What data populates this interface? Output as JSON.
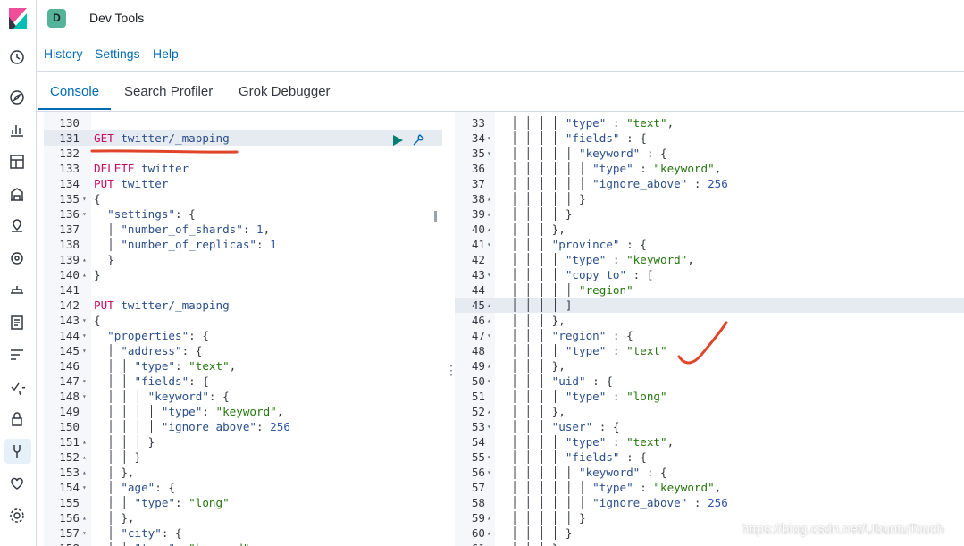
{
  "header": {
    "space_initial": "D",
    "app_title": "Dev Tools"
  },
  "menu": {
    "items": [
      "History",
      "Settings",
      "Help"
    ]
  },
  "tabs": [
    {
      "label": "Console",
      "active": true
    },
    {
      "label": "Search Profiler",
      "active": false
    },
    {
      "label": "Grok Debugger",
      "active": false
    }
  ],
  "rail_icons": [
    "clock-icon",
    "compass-icon",
    "visualize-icon",
    "dashboard-icon",
    "canvas-icon",
    "maps-icon",
    "ml-icon",
    "infrastructure-icon",
    "logs-icon",
    "apm-icon",
    "uptime-icon",
    "siem-icon",
    "dev-tools-icon",
    "monitoring-icon",
    "management-icon"
  ],
  "request_editor": {
    "lines": [
      {
        "n": "130",
        "fold": "",
        "t": []
      },
      {
        "n": "131",
        "fold": "",
        "hl": true,
        "t": [
          [
            "kw",
            "GET "
          ],
          [
            "url",
            "twitter/_mapping"
          ]
        ]
      },
      {
        "n": "132",
        "fold": "",
        "t": []
      },
      {
        "n": "133",
        "fold": "",
        "t": [
          [
            "kw",
            "DELETE "
          ],
          [
            "url",
            "twitter"
          ]
        ]
      },
      {
        "n": "134",
        "fold": "",
        "t": [
          [
            "kw",
            "PUT "
          ],
          [
            "url",
            "twitter"
          ]
        ]
      },
      {
        "n": "135",
        "fold": "▾",
        "t": [
          [
            "pun",
            "{"
          ]
        ]
      },
      {
        "n": "136",
        "fold": "▾",
        "t": [
          [
            "pun",
            "  "
          ],
          [
            "key",
            "\"settings\""
          ],
          [
            "pun",
            ": {"
          ]
        ]
      },
      {
        "n": "137",
        "fold": "",
        "t": [
          [
            "pun",
            "  │ "
          ],
          [
            "key",
            "\"number_of_shards\""
          ],
          [
            "pun",
            ": "
          ],
          [
            "num",
            "1"
          ],
          [
            "pun",
            ","
          ]
        ]
      },
      {
        "n": "138",
        "fold": "",
        "t": [
          [
            "pun",
            "  │ "
          ],
          [
            "key",
            "\"number_of_replicas\""
          ],
          [
            "pun",
            ": "
          ],
          [
            "num",
            "1"
          ]
        ]
      },
      {
        "n": "139",
        "fold": "▴",
        "t": [
          [
            "pun",
            "  }"
          ]
        ]
      },
      {
        "n": "140",
        "fold": "▴",
        "t": [
          [
            "pun",
            "}"
          ]
        ]
      },
      {
        "n": "141",
        "fold": "",
        "t": []
      },
      {
        "n": "142",
        "fold": "",
        "t": [
          [
            "kw",
            "PUT "
          ],
          [
            "url",
            "twitter/_mapping"
          ]
        ]
      },
      {
        "n": "143",
        "fold": "▾",
        "t": [
          [
            "pun",
            "{"
          ]
        ]
      },
      {
        "n": "144",
        "fold": "▾",
        "t": [
          [
            "pun",
            "  "
          ],
          [
            "key",
            "\"properties\""
          ],
          [
            "pun",
            ": {"
          ]
        ]
      },
      {
        "n": "145",
        "fold": "▾",
        "t": [
          [
            "pun",
            "  │ "
          ],
          [
            "key",
            "\"address\""
          ],
          [
            "pun",
            ": {"
          ]
        ]
      },
      {
        "n": "146",
        "fold": "",
        "t": [
          [
            "pun",
            "  │ │ "
          ],
          [
            "key",
            "\"type\""
          ],
          [
            "pun",
            ": "
          ],
          [
            "str",
            "\"text\""
          ],
          [
            "pun",
            ","
          ]
        ]
      },
      {
        "n": "147",
        "fold": "▾",
        "t": [
          [
            "pun",
            "  │ │ "
          ],
          [
            "key",
            "\"fields\""
          ],
          [
            "pun",
            ": {"
          ]
        ]
      },
      {
        "n": "148",
        "fold": "▾",
        "t": [
          [
            "pun",
            "  │ │ │ "
          ],
          [
            "key",
            "\"keyword\""
          ],
          [
            "pun",
            ": {"
          ]
        ]
      },
      {
        "n": "149",
        "fold": "",
        "t": [
          [
            "pun",
            "  │ │ │ │ "
          ],
          [
            "key",
            "\"type\""
          ],
          [
            "pun",
            ": "
          ],
          [
            "str",
            "\"keyword\""
          ],
          [
            "pun",
            ","
          ]
        ]
      },
      {
        "n": "150",
        "fold": "",
        "t": [
          [
            "pun",
            "  │ │ │ │ "
          ],
          [
            "key",
            "\"ignore_above\""
          ],
          [
            "pun",
            ": "
          ],
          [
            "num",
            "256"
          ]
        ]
      },
      {
        "n": "151",
        "fold": "▴",
        "t": [
          [
            "pun",
            "  │ │ │ }"
          ]
        ]
      },
      {
        "n": "152",
        "fold": "▴",
        "t": [
          [
            "pun",
            "  │ │ }"
          ]
        ]
      },
      {
        "n": "153",
        "fold": "▴",
        "t": [
          [
            "pun",
            "  │ },"
          ]
        ]
      },
      {
        "n": "154",
        "fold": "▾",
        "t": [
          [
            "pun",
            "  │ "
          ],
          [
            "key",
            "\"age\""
          ],
          [
            "pun",
            ": {"
          ]
        ]
      },
      {
        "n": "155",
        "fold": "",
        "t": [
          [
            "pun",
            "  │ │ "
          ],
          [
            "key",
            "\"type\""
          ],
          [
            "pun",
            ": "
          ],
          [
            "str",
            "\"long\""
          ]
        ]
      },
      {
        "n": "156",
        "fold": "▴",
        "t": [
          [
            "pun",
            "  │ },"
          ]
        ]
      },
      {
        "n": "157",
        "fold": "▾",
        "t": [
          [
            "pun",
            "  │ "
          ],
          [
            "key",
            "\"city\""
          ],
          [
            "pun",
            ": {"
          ]
        ]
      },
      {
        "n": "158",
        "fold": "",
        "t": [
          [
            "pun",
            "  │ │ "
          ],
          [
            "key",
            "\"type\""
          ],
          [
            "pun",
            ": "
          ],
          [
            "str",
            "\"keyword\""
          ]
        ]
      }
    ]
  },
  "response_editor": {
    "lines": [
      {
        "n": "33",
        "fold": "",
        "t": [
          [
            "pun",
            "  │ │ │ │ "
          ],
          [
            "key",
            "\"type\""
          ],
          [
            "pun",
            " : "
          ],
          [
            "str",
            "\"text\""
          ],
          [
            "pun",
            ","
          ]
        ]
      },
      {
        "n": "34",
        "fold": "▾",
        "t": [
          [
            "pun",
            "  │ │ │ │ "
          ],
          [
            "key",
            "\"fields\""
          ],
          [
            "pun",
            " : {"
          ]
        ]
      },
      {
        "n": "35",
        "fold": "▾",
        "t": [
          [
            "pun",
            "  │ │ │ │ │ "
          ],
          [
            "key",
            "\"keyword\""
          ],
          [
            "pun",
            " : {"
          ]
        ]
      },
      {
        "n": "36",
        "fold": "",
        "t": [
          [
            "pun",
            "  │ │ │ │ │ │ "
          ],
          [
            "key",
            "\"type\""
          ],
          [
            "pun",
            " : "
          ],
          [
            "str",
            "\"keyword\""
          ],
          [
            "pun",
            ","
          ]
        ]
      },
      {
        "n": "37",
        "fold": "",
        "t": [
          [
            "pun",
            "  │ │ │ │ │ │ "
          ],
          [
            "key",
            "\"ignore_above\""
          ],
          [
            "pun",
            " : "
          ],
          [
            "num",
            "256"
          ]
        ]
      },
      {
        "n": "38",
        "fold": "▴",
        "t": [
          [
            "pun",
            "  │ │ │ │ │ }"
          ]
        ]
      },
      {
        "n": "39",
        "fold": "▴",
        "t": [
          [
            "pun",
            "  │ │ │ │ }"
          ]
        ]
      },
      {
        "n": "40",
        "fold": "▴",
        "t": [
          [
            "pun",
            "  │ │ │ },"
          ]
        ]
      },
      {
        "n": "41",
        "fold": "▾",
        "t": [
          [
            "pun",
            "  │ │ │ "
          ],
          [
            "key",
            "\"province\""
          ],
          [
            "pun",
            " : {"
          ]
        ]
      },
      {
        "n": "42",
        "fold": "",
        "t": [
          [
            "pun",
            "  │ │ │ │ "
          ],
          [
            "key",
            "\"type\""
          ],
          [
            "pun",
            " : "
          ],
          [
            "str",
            "\"keyword\""
          ],
          [
            "pun",
            ","
          ]
        ]
      },
      {
        "n": "43",
        "fold": "▾",
        "t": [
          [
            "pun",
            "  │ │ │ │ "
          ],
          [
            "key",
            "\"copy_to\""
          ],
          [
            "pun",
            " : ["
          ]
        ]
      },
      {
        "n": "44",
        "fold": "",
        "t": [
          [
            "pun",
            "  │ │ │ │ │ "
          ],
          [
            "str",
            "\"region\""
          ]
        ]
      },
      {
        "n": "45",
        "fold": "▴",
        "hl": true,
        "t": [
          [
            "pun",
            "  │ │ │ │ ]"
          ]
        ]
      },
      {
        "n": "46",
        "fold": "▴",
        "t": [
          [
            "pun",
            "  │ │ │ },"
          ]
        ]
      },
      {
        "n": "47",
        "fold": "▾",
        "t": [
          [
            "pun",
            "  │ │ │ "
          ],
          [
            "key",
            "\"region\""
          ],
          [
            "pun",
            " : {"
          ]
        ]
      },
      {
        "n": "48",
        "fold": "",
        "t": [
          [
            "pun",
            "  │ │ │ │ "
          ],
          [
            "key",
            "\"type\""
          ],
          [
            "pun",
            " : "
          ],
          [
            "str",
            "\"text\""
          ]
        ]
      },
      {
        "n": "49",
        "fold": "▴",
        "t": [
          [
            "pun",
            "  │ │ │ },"
          ]
        ]
      },
      {
        "n": "50",
        "fold": "▾",
        "t": [
          [
            "pun",
            "  │ │ │ "
          ],
          [
            "key",
            "\"uid\""
          ],
          [
            "pun",
            " : {"
          ]
        ]
      },
      {
        "n": "51",
        "fold": "",
        "t": [
          [
            "pun",
            "  │ │ │ │ "
          ],
          [
            "key",
            "\"type\""
          ],
          [
            "pun",
            " : "
          ],
          [
            "str",
            "\"long\""
          ]
        ]
      },
      {
        "n": "52",
        "fold": "▴",
        "t": [
          [
            "pun",
            "  │ │ │ },"
          ]
        ]
      },
      {
        "n": "53",
        "fold": "▾",
        "t": [
          [
            "pun",
            "  │ │ │ "
          ],
          [
            "key",
            "\"user\""
          ],
          [
            "pun",
            " : {"
          ]
        ]
      },
      {
        "n": "54",
        "fold": "",
        "t": [
          [
            "pun",
            "  │ │ │ │ "
          ],
          [
            "key",
            "\"type\""
          ],
          [
            "pun",
            " : "
          ],
          [
            "str",
            "\"text\""
          ],
          [
            "pun",
            ","
          ]
        ]
      },
      {
        "n": "55",
        "fold": "▾",
        "t": [
          [
            "pun",
            "  │ │ │ │ "
          ],
          [
            "key",
            "\"fields\""
          ],
          [
            "pun",
            " : {"
          ]
        ]
      },
      {
        "n": "56",
        "fold": "▾",
        "t": [
          [
            "pun",
            "  │ │ │ │ │ "
          ],
          [
            "key",
            "\"keyword\""
          ],
          [
            "pun",
            " : {"
          ]
        ]
      },
      {
        "n": "57",
        "fold": "",
        "t": [
          [
            "pun",
            "  │ │ │ │ │ │ "
          ],
          [
            "key",
            "\"type\""
          ],
          [
            "pun",
            " : "
          ],
          [
            "str",
            "\"keyword\""
          ],
          [
            "pun",
            ","
          ]
        ]
      },
      {
        "n": "58",
        "fold": "",
        "t": [
          [
            "pun",
            "  │ │ │ │ │ │ "
          ],
          [
            "key",
            "\"ignore_above\""
          ],
          [
            "pun",
            " : "
          ],
          [
            "num",
            "256"
          ]
        ]
      },
      {
        "n": "59",
        "fold": "▴",
        "t": [
          [
            "pun",
            "  │ │ │ │ │ }"
          ]
        ]
      },
      {
        "n": "60",
        "fold": "▴",
        "t": [
          [
            "pun",
            "  │ │ │ │ }"
          ]
        ]
      },
      {
        "n": "61",
        "fold": "▴",
        "t": [
          [
            "pun",
            "  │ │ │ }"
          ]
        ]
      }
    ]
  },
  "watermark": "https://blog.csdn.net/UbuntuTouch",
  "colors": {
    "accent": "#006bb4",
    "annotation": "#e0452c",
    "run": "#017d73"
  }
}
